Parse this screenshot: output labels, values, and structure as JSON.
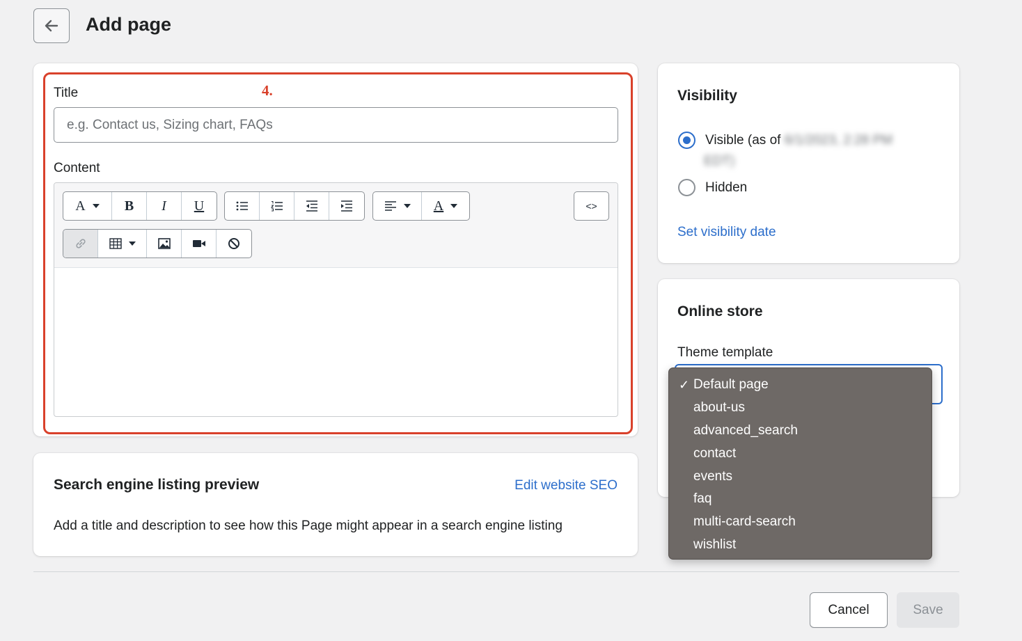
{
  "header": {
    "title": "Add page"
  },
  "annotation": {
    "step": "4."
  },
  "main": {
    "title_label": "Title",
    "title_placeholder": "e.g. Contact us, Sizing chart, FAQs",
    "title_value": "",
    "content_label": "Content",
    "toolbar": {
      "font_glyph": "A",
      "bold_glyph": "B",
      "italic_glyph": "I",
      "underline_glyph": "U",
      "text_color_glyph": "A",
      "source_glyph": "<>"
    }
  },
  "seo": {
    "title": "Search engine listing preview",
    "edit_link": "Edit website SEO",
    "description": "Add a title and description to see how this Page might appear in a search engine listing"
  },
  "visibility": {
    "title": "Visibility",
    "visible_label": "Visible (as of",
    "visible_date": "6/1/2023, 2:28 PM",
    "visible_tz": "EDT)",
    "hidden_label": "Hidden",
    "set_date_link": "Set visibility date",
    "selected": "visible"
  },
  "online_store": {
    "title": "Online store",
    "theme_label": "Theme template",
    "options": [
      {
        "label": "Default page",
        "checked": "✓"
      },
      {
        "label": "about-us",
        "checked": ""
      },
      {
        "label": "advanced_search",
        "checked": ""
      },
      {
        "label": "contact",
        "checked": ""
      },
      {
        "label": "events",
        "checked": ""
      },
      {
        "label": "faq",
        "checked": ""
      },
      {
        "label": "multi-card-search",
        "checked": ""
      },
      {
        "label": "wishlist",
        "checked": ""
      }
    ]
  },
  "footer": {
    "cancel": "Cancel",
    "save": "Save"
  },
  "colors": {
    "accent": "#2c6ecb",
    "highlight": "#d9412b",
    "dropdown_bg": "#6e6966"
  }
}
